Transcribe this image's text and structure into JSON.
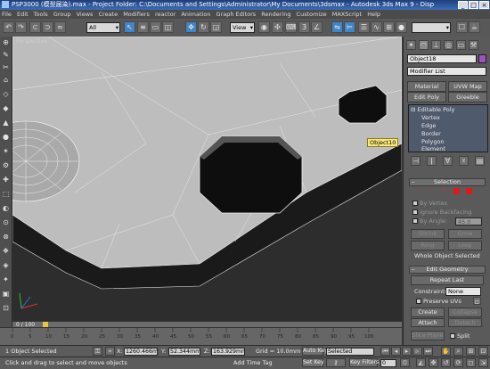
{
  "window": {
    "title": "PSP3000 (模型届染).max - Project Folder: C:\\Documents and Settings\\Administrator\\My Documents\\3dsmax - Autodesk 3ds Max 9 - Disp",
    "min": "_",
    "max": "□",
    "close": "×"
  },
  "menu": [
    "File",
    "Edit",
    "Tools",
    "Group",
    "Views",
    "Create",
    "Modifiers",
    "reactor",
    "Animation",
    "Graph Editors",
    "Rendering",
    "Customize",
    "MAXScript",
    "Help"
  ],
  "toolbar": {
    "selection_filter": "All",
    "ref_coord": "View"
  },
  "viewport": {
    "label": "Perspective",
    "object_tag": "Object10"
  },
  "panel": {
    "object_name": "Object18",
    "modifier_list": "Modifier List",
    "mod_buttons": [
      "Material",
      "UVW Map",
      "Edit Poly",
      "Greeble"
    ],
    "stack": {
      "root": "Editable Poly",
      "subs": [
        "Vertex",
        "Edge",
        "Border",
        "Polygon",
        "Element"
      ]
    },
    "selection": {
      "header": "Selection",
      "by_vertex": "By Vertex",
      "ignore_backfacing": "Ignore Backfacing",
      "by_angle": "By Angle:",
      "angle_value": "45.0",
      "shrink": "Shrink",
      "grow": "Grow",
      "ring": "Ring",
      "loop": "Loop",
      "status": "Whole Object Selected"
    },
    "edit_geometry": {
      "header": "Edit Geometry",
      "repeat_last": "Repeat Last",
      "constraints_label": "Constraints:",
      "constraints_value": "None",
      "preserve_uvs": "Preserve UVs",
      "create": "Create",
      "collapse": "Collapse",
      "attach": "Attach",
      "detach": "Detach",
      "slice_plane": "Slice Plane",
      "split": "Split"
    }
  },
  "timeline": {
    "frame": "0 / 100",
    "ticks": [
      "0",
      "5",
      "10",
      "15",
      "20",
      "25",
      "30",
      "35",
      "40",
      "45",
      "50",
      "55",
      "60",
      "65",
      "70",
      "75",
      "80",
      "85",
      "90",
      "95",
      "100"
    ]
  },
  "status": {
    "selected": "1 Object Selected",
    "prompt": "Click and drag to select and move objects",
    "x_label": "X:",
    "x_value": "1260.466m",
    "y_label": "Y:",
    "y_value": "52.344mm",
    "z_label": "Z:",
    "z_value": "163.929mm",
    "grid": "Grid = 10.0mm",
    "add_time_tag": "Add Time Tag",
    "auto_key": "Auto Key",
    "set_key": "Set Key",
    "key_mode": "Selected",
    "key_filters": "Key Filters...",
    "frame_value": "0"
  }
}
